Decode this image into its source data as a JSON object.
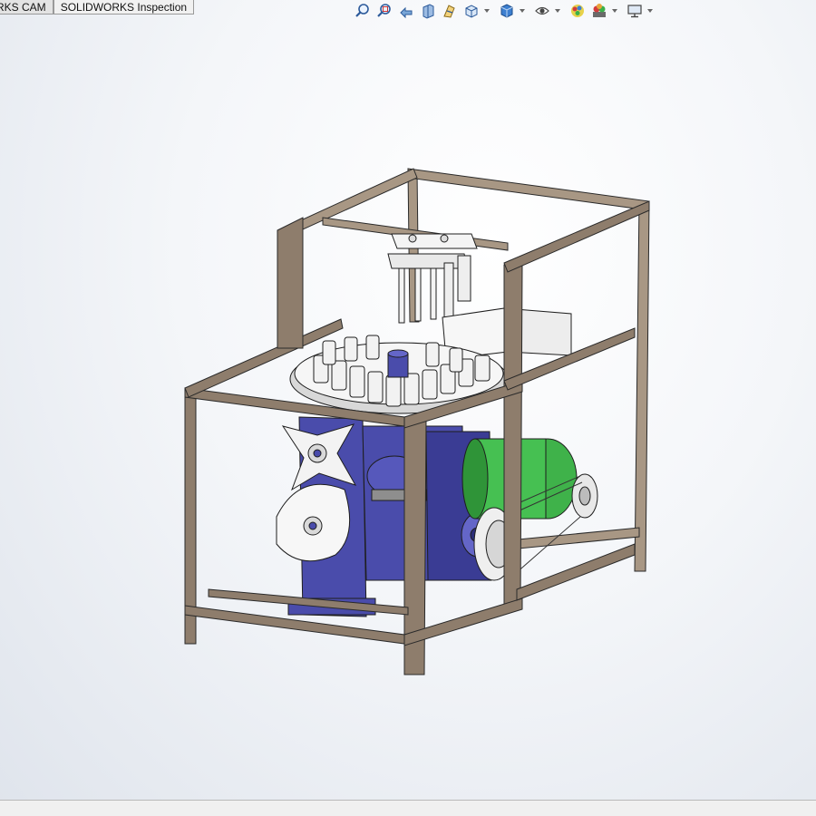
{
  "tabs": [
    {
      "label": "RKS CAM"
    },
    {
      "label": "SOLIDWORKS Inspection"
    }
  ],
  "toolbar": {
    "icons": [
      "zoom-to-fit-icon",
      "zoom-to-area-icon",
      "previous-view-icon",
      "section-view-icon",
      "dynamic-annotation-views-icon",
      "view-orientation-icon",
      "display-style-icon",
      "hide-show-items-icon",
      "edit-appearance-icon",
      "apply-scene-icon",
      "view-settings-icon"
    ]
  },
  "colors": {
    "frame": "#8e7d6c",
    "frame_light": "#b5a593",
    "gearbox": "#4a4cab",
    "motor": "#3fb24a",
    "parts": "#f2f2f2",
    "background_top": "#ffffff",
    "background_bottom": "#dfe4ec"
  }
}
